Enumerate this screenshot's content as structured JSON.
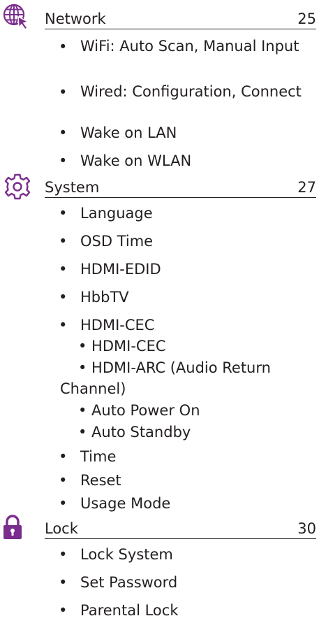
{
  "colors": {
    "accent_purple": "#7b2d8e",
    "text": "#231f20"
  },
  "sections": [
    {
      "title": "Network",
      "page": "25",
      "icon": "network-globe-cursor-icon",
      "items": [
        "WiFi: Auto Scan, Manual Input",
        "Wired: Configuration, Connect",
        "Wake on LAN",
        "Wake on WLAN"
      ]
    },
    {
      "title": "System",
      "page": "27",
      "icon": "gear-icon",
      "items": [
        "Language",
        "OSD Time",
        "HDMI-EDID",
        "HbbTV",
        "HDMI-CEC",
        "Time",
        "Reset",
        "Usage Mode"
      ],
      "hdmi_cec_subitems": [
        "• HDMI-CEC",
        "• HDMI-ARC (Audio Return",
        "Channel)",
        "• Auto Power On",
        "• Auto Standby"
      ]
    },
    {
      "title": "Lock",
      "page": "30",
      "icon": "padlock-icon",
      "items": [
        "Lock System",
        "Set Password",
        "Parental Lock"
      ]
    }
  ],
  "bullet": "•"
}
